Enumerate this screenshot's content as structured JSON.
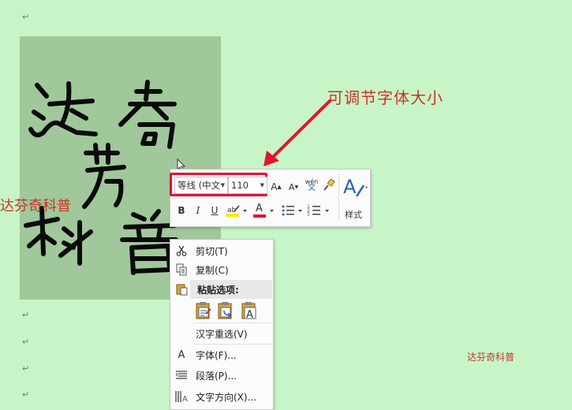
{
  "document": {
    "inline_text_left": "达芬奇科普",
    "inline_text_right": "达芬奇科普",
    "para_mark": "↵",
    "image_calligraphy": [
      "达",
      "奇",
      "芬",
      "科",
      "普"
    ]
  },
  "annotation": {
    "text": "可调节字体大小",
    "color": "#c8352a",
    "arrow_color": "#e8102e"
  },
  "mini_toolbar": {
    "font_name": "等线 (中文",
    "font_size": "110",
    "grow_font": "A",
    "shrink_font": "A",
    "phonetic_top": "wén",
    "phonetic_bottom": "文",
    "styles_label": "样式",
    "bold": "B",
    "italic": "I",
    "underline": "U",
    "font_color_letter": "A",
    "highlight_color": "#ffe600",
    "font_color": "#e8102e"
  },
  "context_menu": {
    "cut": "剪切(T)",
    "copy": "复制(C)",
    "paste_options": "粘贴选项:",
    "reconvert": "汉字重选(V)",
    "font": "字体(F)...",
    "paragraph": "段落(P)...",
    "text_direction": "文字方向(X)..."
  }
}
